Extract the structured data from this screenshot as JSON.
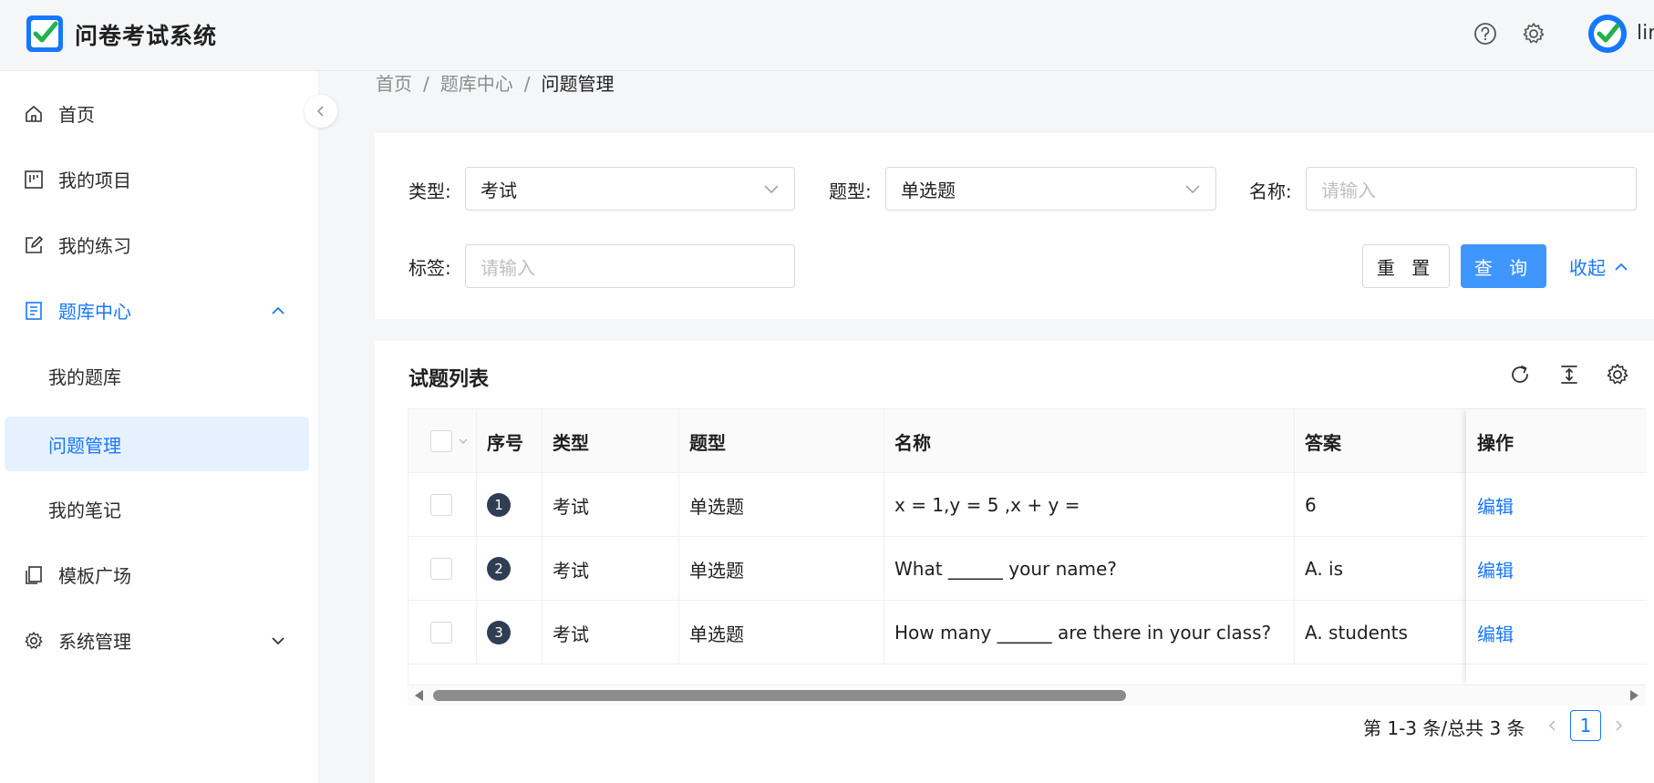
{
  "header": {
    "app_title": "问卷考试系统",
    "username": "lin",
    "accent": "#1677ff"
  },
  "sidebar": {
    "items": [
      {
        "label": "首页",
        "icon": "home-icon"
      },
      {
        "label": "我的项目",
        "icon": "project-icon"
      },
      {
        "label": "我的练习",
        "icon": "edit-icon"
      },
      {
        "label": "题库中心",
        "icon": "question-bank-icon",
        "expanded": true
      },
      {
        "label": "模板广场",
        "icon": "template-icon"
      },
      {
        "label": "系统管理",
        "icon": "gear-icon",
        "expanded": false
      }
    ],
    "submenu": [
      {
        "label": "我的题库"
      },
      {
        "label": "问题管理",
        "selected": true
      },
      {
        "label": "我的笔记"
      }
    ]
  },
  "breadcrumb": {
    "items": [
      "首页",
      "题库中心",
      "问题管理"
    ],
    "separator": "/"
  },
  "search": {
    "type_label": "类型:",
    "type_value": "考试",
    "qtype_label": "题型:",
    "qtype_value": "单选题",
    "name_label": "名称:",
    "name_placeholder": "请输入",
    "tag_label": "标签:",
    "tag_placeholder": "请输入",
    "reset_label": "重 置",
    "query_label": "查 询",
    "collapse_label": "收起"
  },
  "table": {
    "title": "试题列表",
    "columns": [
      "序号",
      "类型",
      "题型",
      "名称",
      "答案",
      "操作"
    ],
    "rows": [
      {
        "index": "1",
        "type": "考试",
        "qtype": "单选题",
        "name": "x = 1,y = 5 ,x + y =",
        "answer": "6",
        "action": "编辑"
      },
      {
        "index": "2",
        "type": "考试",
        "qtype": "单选题",
        "name": "What ______ your name?",
        "answer": "A. is",
        "action": "编辑"
      },
      {
        "index": "3",
        "type": "考试",
        "qtype": "单选题",
        "name": "How many ______ are there in your class?",
        "answer": "A. students",
        "action": "编辑"
      }
    ]
  },
  "pagination": {
    "total_text": "第 1-3 条/总共 3 条",
    "current_page": "1"
  }
}
